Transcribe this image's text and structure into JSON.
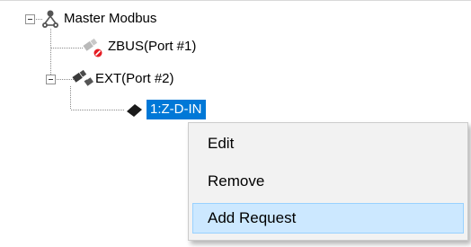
{
  "tree": {
    "root": {
      "label": "Master Modbus",
      "expanded": true,
      "icon": "network-topology-icon"
    },
    "ports": [
      {
        "label": "ZBUS(Port #1)",
        "icon": "port-disabled-icon",
        "status_color": "#e51c23"
      },
      {
        "label": "EXT(Port #2)",
        "icon": "port-connected-icon",
        "expanded": true,
        "children": [
          {
            "label": "1:Z-D-IN",
            "icon": "device-diamond-icon",
            "selected": true
          }
        ]
      }
    ],
    "selection_color": "#0078d7"
  },
  "context_menu": {
    "items": [
      {
        "label": "Edit"
      },
      {
        "label": "Remove"
      },
      {
        "label": "Add Request",
        "highlighted": true
      }
    ],
    "highlight_color": "#cce8ff"
  }
}
